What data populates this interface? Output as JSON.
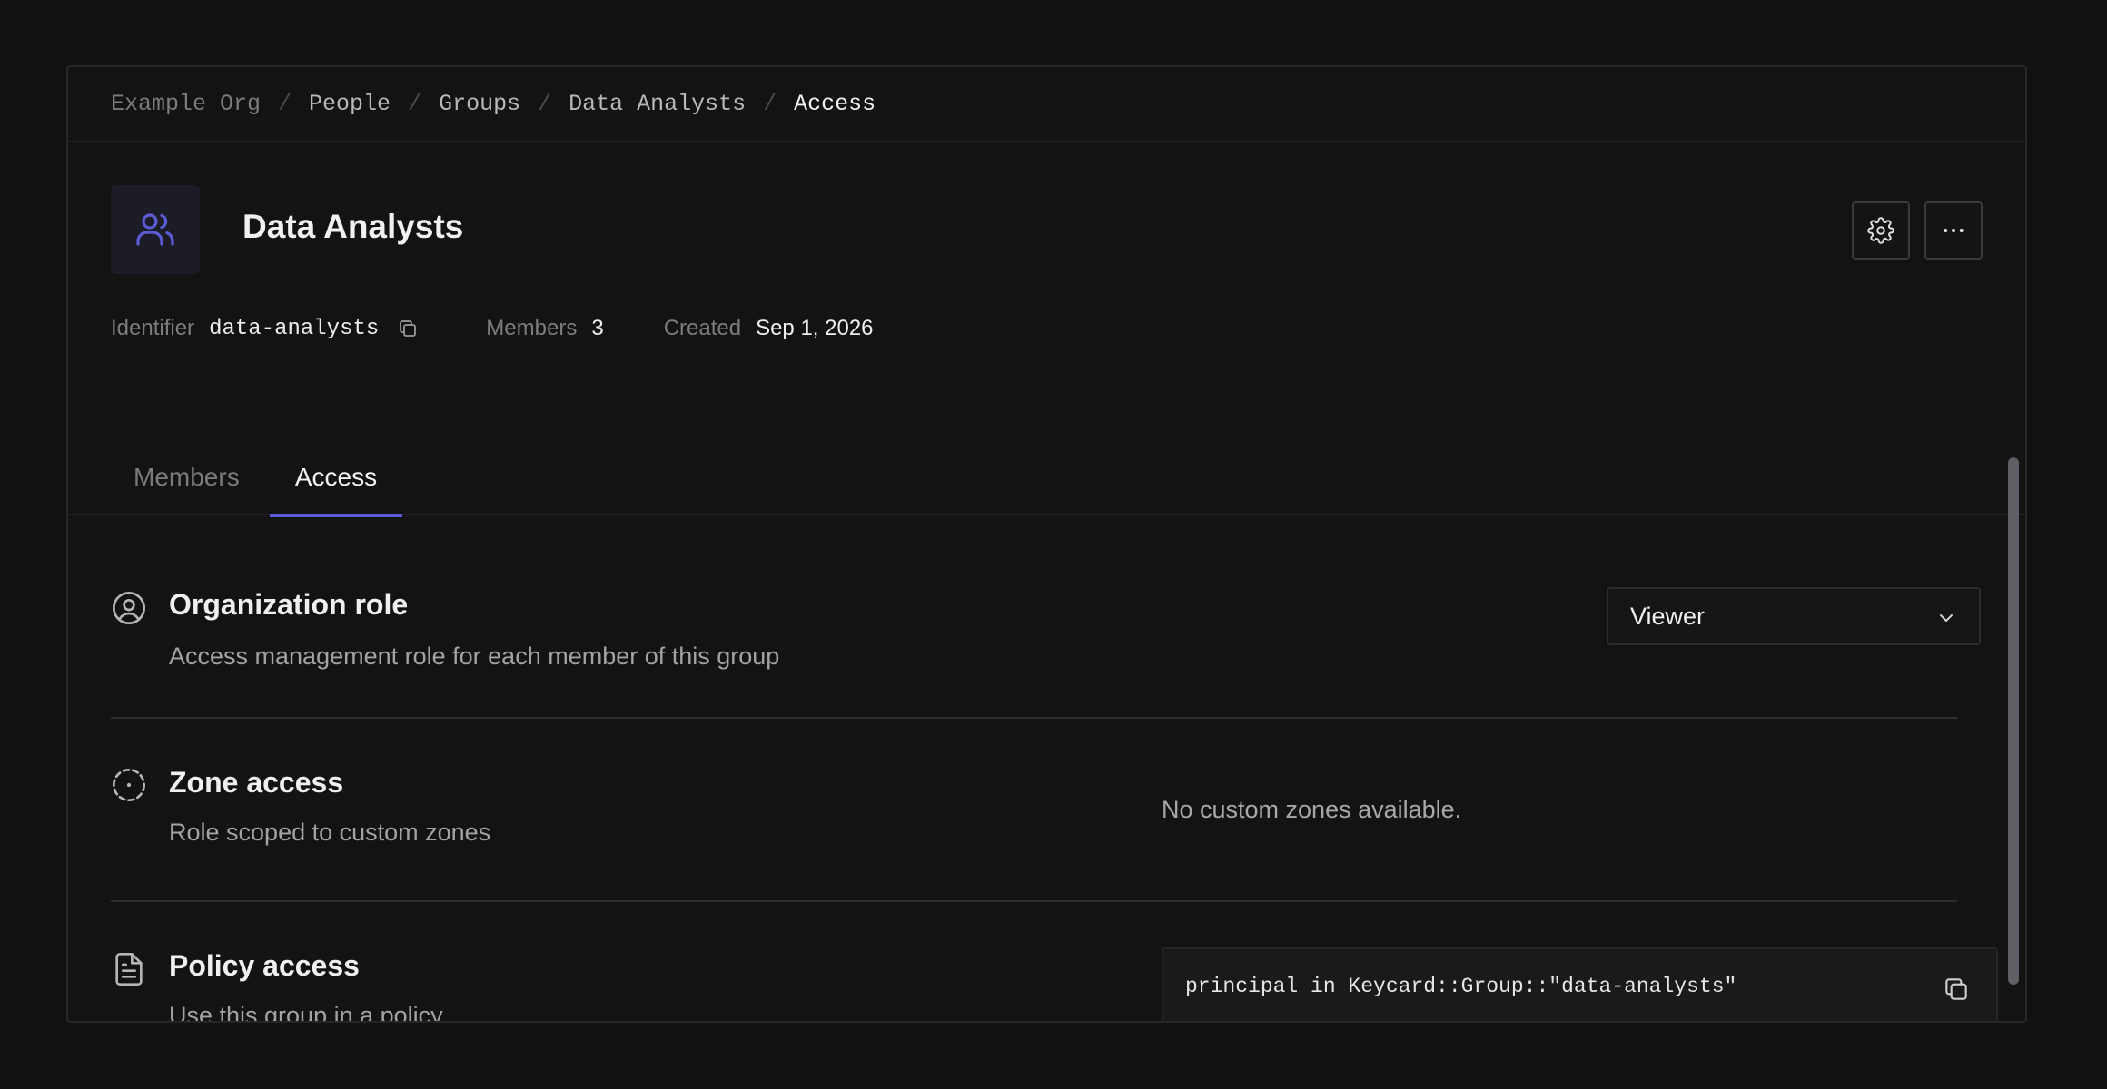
{
  "breadcrumb": {
    "items": [
      "Example Org",
      "People",
      "Groups",
      "Data Analysts",
      "Access"
    ],
    "separator": "/"
  },
  "group": {
    "name": "Data Analysts",
    "icon": "users-icon",
    "accent_color": "#5b5bd6"
  },
  "meta": {
    "identifier_label": "Identifier",
    "identifier_value": "data-analysts",
    "members_label": "Members",
    "members_value": "3",
    "created_label": "Created",
    "created_value": "Sep 1, 2026"
  },
  "actions": {
    "settings_icon": "gear-icon",
    "more_icon": "more-horizontal-icon"
  },
  "tabs": [
    {
      "label": "Members",
      "active": false
    },
    {
      "label": "Access",
      "active": true
    }
  ],
  "sections": {
    "org_role": {
      "title": "Organization role",
      "description": "Access management role for each member of this group",
      "icon": "user-circle-icon",
      "selected_role": "Viewer"
    },
    "zone_access": {
      "title": "Zone access",
      "description": "Role scoped to custom zones",
      "icon": "dashed-circle-icon",
      "empty_text": "No custom zones available."
    },
    "policy_access": {
      "title": "Policy access",
      "description": "Use this group in a policy",
      "icon": "document-icon",
      "code": "principal in Keycard::Group::\"data-analysts\""
    }
  }
}
